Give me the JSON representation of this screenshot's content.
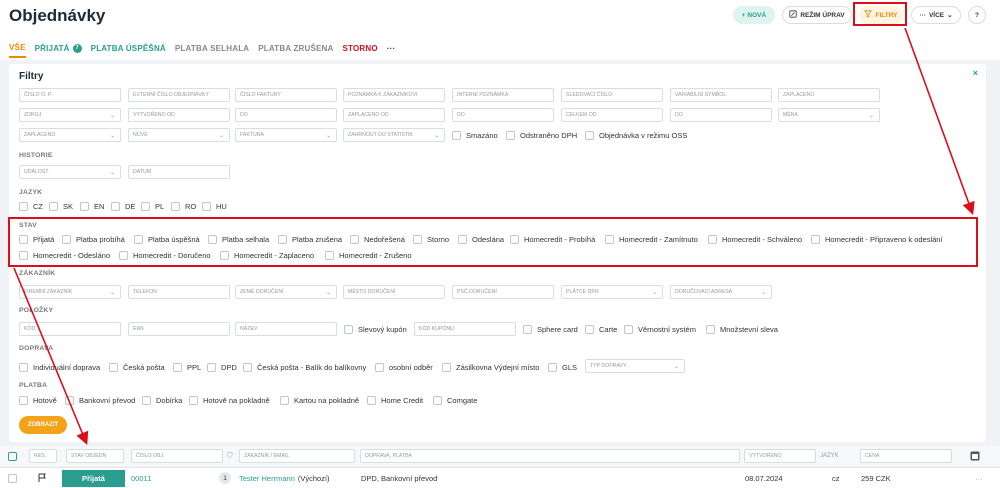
{
  "header": {
    "title": "Objednávky",
    "buttons": {
      "new": "+ NOVÁ",
      "edit": "REŽIM ÚPRAV",
      "filter": "FILTRY",
      "more": "VÍCE",
      "help": "?"
    },
    "more_prefix": "···"
  },
  "tabs": [
    {
      "label": "VŠE"
    },
    {
      "label": "PŘIJATÁ",
      "badge": "7"
    },
    {
      "label": "PLATBA ÚSPĚŠNÁ"
    },
    {
      "label": "PLATBA SELHALA"
    },
    {
      "label": "PLATBA ZRUŠENA"
    },
    {
      "label": "STORNO"
    },
    {
      "label": "···"
    }
  ],
  "filters": {
    "title": "Filtry",
    "close": "×",
    "row1": [
      "ČÍSLO O. P.",
      "EXTERNÍ ČÍSLO OBJEDNÁVKY",
      "ČÍSLO FAKTURY",
      "POZNÁMKA K ZÁKAZNÍKOVI",
      "INTERNÍ POZNÁMKA",
      "SLEDOVACÍ ČÍSLO",
      "VARIABILNÍ SYMBOL",
      "ZAPLACENO"
    ],
    "row2": [
      "ZDROJ",
      "VYTVOŘENO OD",
      "DO",
      "ZAPLACENO OD",
      "DO",
      "CELKEM OD",
      "DO",
      "MĚNA"
    ],
    "row3": [
      "ZAPLACENO",
      "NOVÉ",
      "FAKTURA",
      "ZAHRNOUT DO STATISTIK"
    ],
    "row3_checks": [
      "Smazáno",
      "Odstraněno DPH",
      "Objednávka v režimu OSS"
    ],
    "historie_label": "HISTORIE",
    "historie": [
      "UDÁLOST",
      "DATUM"
    ],
    "jazyk_label": "JAZYK",
    "jazyk": [
      "CZ",
      "SK",
      "EN",
      "DE",
      "PL",
      "RO",
      "HU"
    ],
    "stav_label": "STAV",
    "stav_row1": [
      "Přijatá",
      "Platba probíhá",
      "Platba úspěšná",
      "Platba selhala",
      "Platba zrušena",
      "Nedořešená",
      "Storno",
      "Odeslána",
      "Homecredit - Probíhá",
      "Homecredit - Zamítnuto",
      "Homecredit - Schváleno",
      "Homecredit - Připraveno k odeslání"
    ],
    "stav_row2": [
      "Homecredit - Odesláno",
      "Homecredit - Doručeno",
      "Homecredit - Zaplaceno",
      "Homecredit - Zrušeno"
    ],
    "zakaznik_label": "ZÁKAZNÍK",
    "zakaznik": [
      "FIREMNÍ ZÁKAZNÍK",
      "TELEFON",
      "ZEMĚ DORUČENÍ",
      "MĚSTO DORUČENÍ",
      "PSČ DORUČENÍ",
      "PLÁTCE DPH",
      "DORUČOVACÍ ADRESA"
    ],
    "polozky_label": "POLOŽKY",
    "polozky": [
      "KÓD",
      "EAN",
      "NÁZEV"
    ],
    "polozky_check": "Slevový kupón",
    "polozky_kupon": "KÓD KUPÓNU",
    "polozky_checks2": [
      "Sphere card",
      "Carte",
      "Věrnostní systém",
      "Množstevní sleva"
    ],
    "doprava_label": "DOPRAVA",
    "doprava": [
      "Individuální doprava",
      "Česká pošta",
      "PPL",
      "DPD",
      "Česká pošta - Balík do balíkovny",
      "osobní odběr",
      "Zásilkovna Výdejní místo",
      "GLS"
    ],
    "doprava_select": "TYP DOPRAVY",
    "platba_label": "PLATBA",
    "platba": [
      "Hotově",
      "Bankovní převod",
      "Dobírka",
      "Hotově na pokladně",
      "Kartou na pokladně",
      "Home Credit",
      "Comgate"
    ],
    "submit": "ZOBRAZIT"
  },
  "table": {
    "headers": {
      "res": "RES.",
      "stav": "STAV OBJEDN",
      "cislo": "ČÍSLO OBJ.",
      "zakaznik": "ZÁKAZNÍK / EMAIL",
      "doprava": "DOPRAVA, PLATBA",
      "vytvoreno": "VYTVOŘENO",
      "jazyk": "JAZYK",
      "cena": "CENA"
    },
    "row": {
      "status": "Přijatá",
      "number": "00011",
      "count": "1",
      "customer": "Tester Herrmann",
      "customer_note": "(Výchozí)",
      "shipping": "DPD, Bankovní převod",
      "date": "08.07.2024",
      "lang": "cz",
      "price": "259 CZK",
      "more": "···"
    }
  },
  "colors": {
    "accent": "#e8890c",
    "teal": "#2a9d8f",
    "highlight": "#d90f1a"
  }
}
